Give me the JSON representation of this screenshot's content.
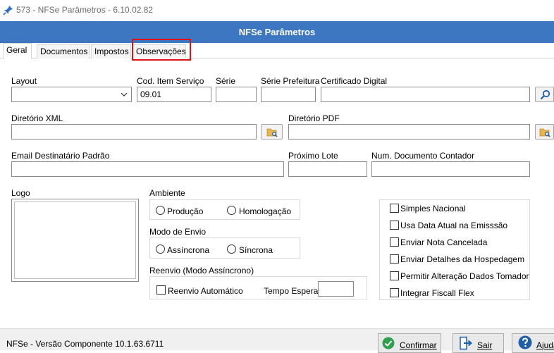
{
  "window": {
    "title": "573 - NFSe Parâmetros - 6.10.02.82"
  },
  "header": {
    "title": "NFSe Parâmetros"
  },
  "tabs": [
    {
      "label": "Geral"
    },
    {
      "label": "Documentos"
    },
    {
      "label": "Impostos"
    },
    {
      "label": "Observações"
    }
  ],
  "form": {
    "layout_label": "Layout",
    "layout_value": "",
    "cod_item_label": "Cod. Item Serviço",
    "cod_item_value": "09.01",
    "serie_label": "Série",
    "serie_value": "",
    "serie_prefeitura_label": "Série Prefeitura",
    "serie_prefeitura_value": "",
    "certificado_label": "Certificado Digital",
    "certificado_value": "",
    "diretorio_xml_label": "Diretório XML",
    "diretorio_xml_value": "",
    "diretorio_pdf_label": "Diretório PDF",
    "diretorio_pdf_value": "",
    "email_label": "Email Destinatário Padrão",
    "email_value": "",
    "proximo_lote_label": "Próximo Lote",
    "proximo_lote_value": "",
    "num_doc_contador_label": "Num. Documento Contador",
    "num_doc_contador_value": "",
    "logo_label": "Logo"
  },
  "ambiente": {
    "label": "Ambiente",
    "options": [
      "Produção",
      "Homologação"
    ]
  },
  "modo_envio": {
    "label": "Modo de Envio",
    "options": [
      "Assíncrona",
      "Síncrona"
    ]
  },
  "reenvio": {
    "label": "Reenvio (Modo Assíncrono)",
    "auto_label": "Reenvio Automático",
    "tempo_label": "Tempo Espera",
    "tempo_value": ""
  },
  "options": [
    {
      "label": "Simples Nacional",
      "checked": false
    },
    {
      "label": "Usa Data Atual na Emisssão",
      "checked": false
    },
    {
      "label": "Enviar Nota Cancelada",
      "checked": false
    },
    {
      "label": "Enviar Detalhes da Hospedagem",
      "checked": false
    },
    {
      "label": "Permitir Alteração Dados Tomador",
      "checked": false
    },
    {
      "label": "Integrar Fiscall Flex",
      "checked": false
    }
  ],
  "status": {
    "text": "NFSe - Versão Componente 10.1.63.6711"
  },
  "buttons": {
    "confirm": "Confirmar",
    "exit": "Sair",
    "help": "Ajuda"
  },
  "colors": {
    "header": "#3d77c2",
    "highlight": "#e01010",
    "confirm_icon": "#2e9e4f",
    "help_icon": "#1f5fa8"
  }
}
